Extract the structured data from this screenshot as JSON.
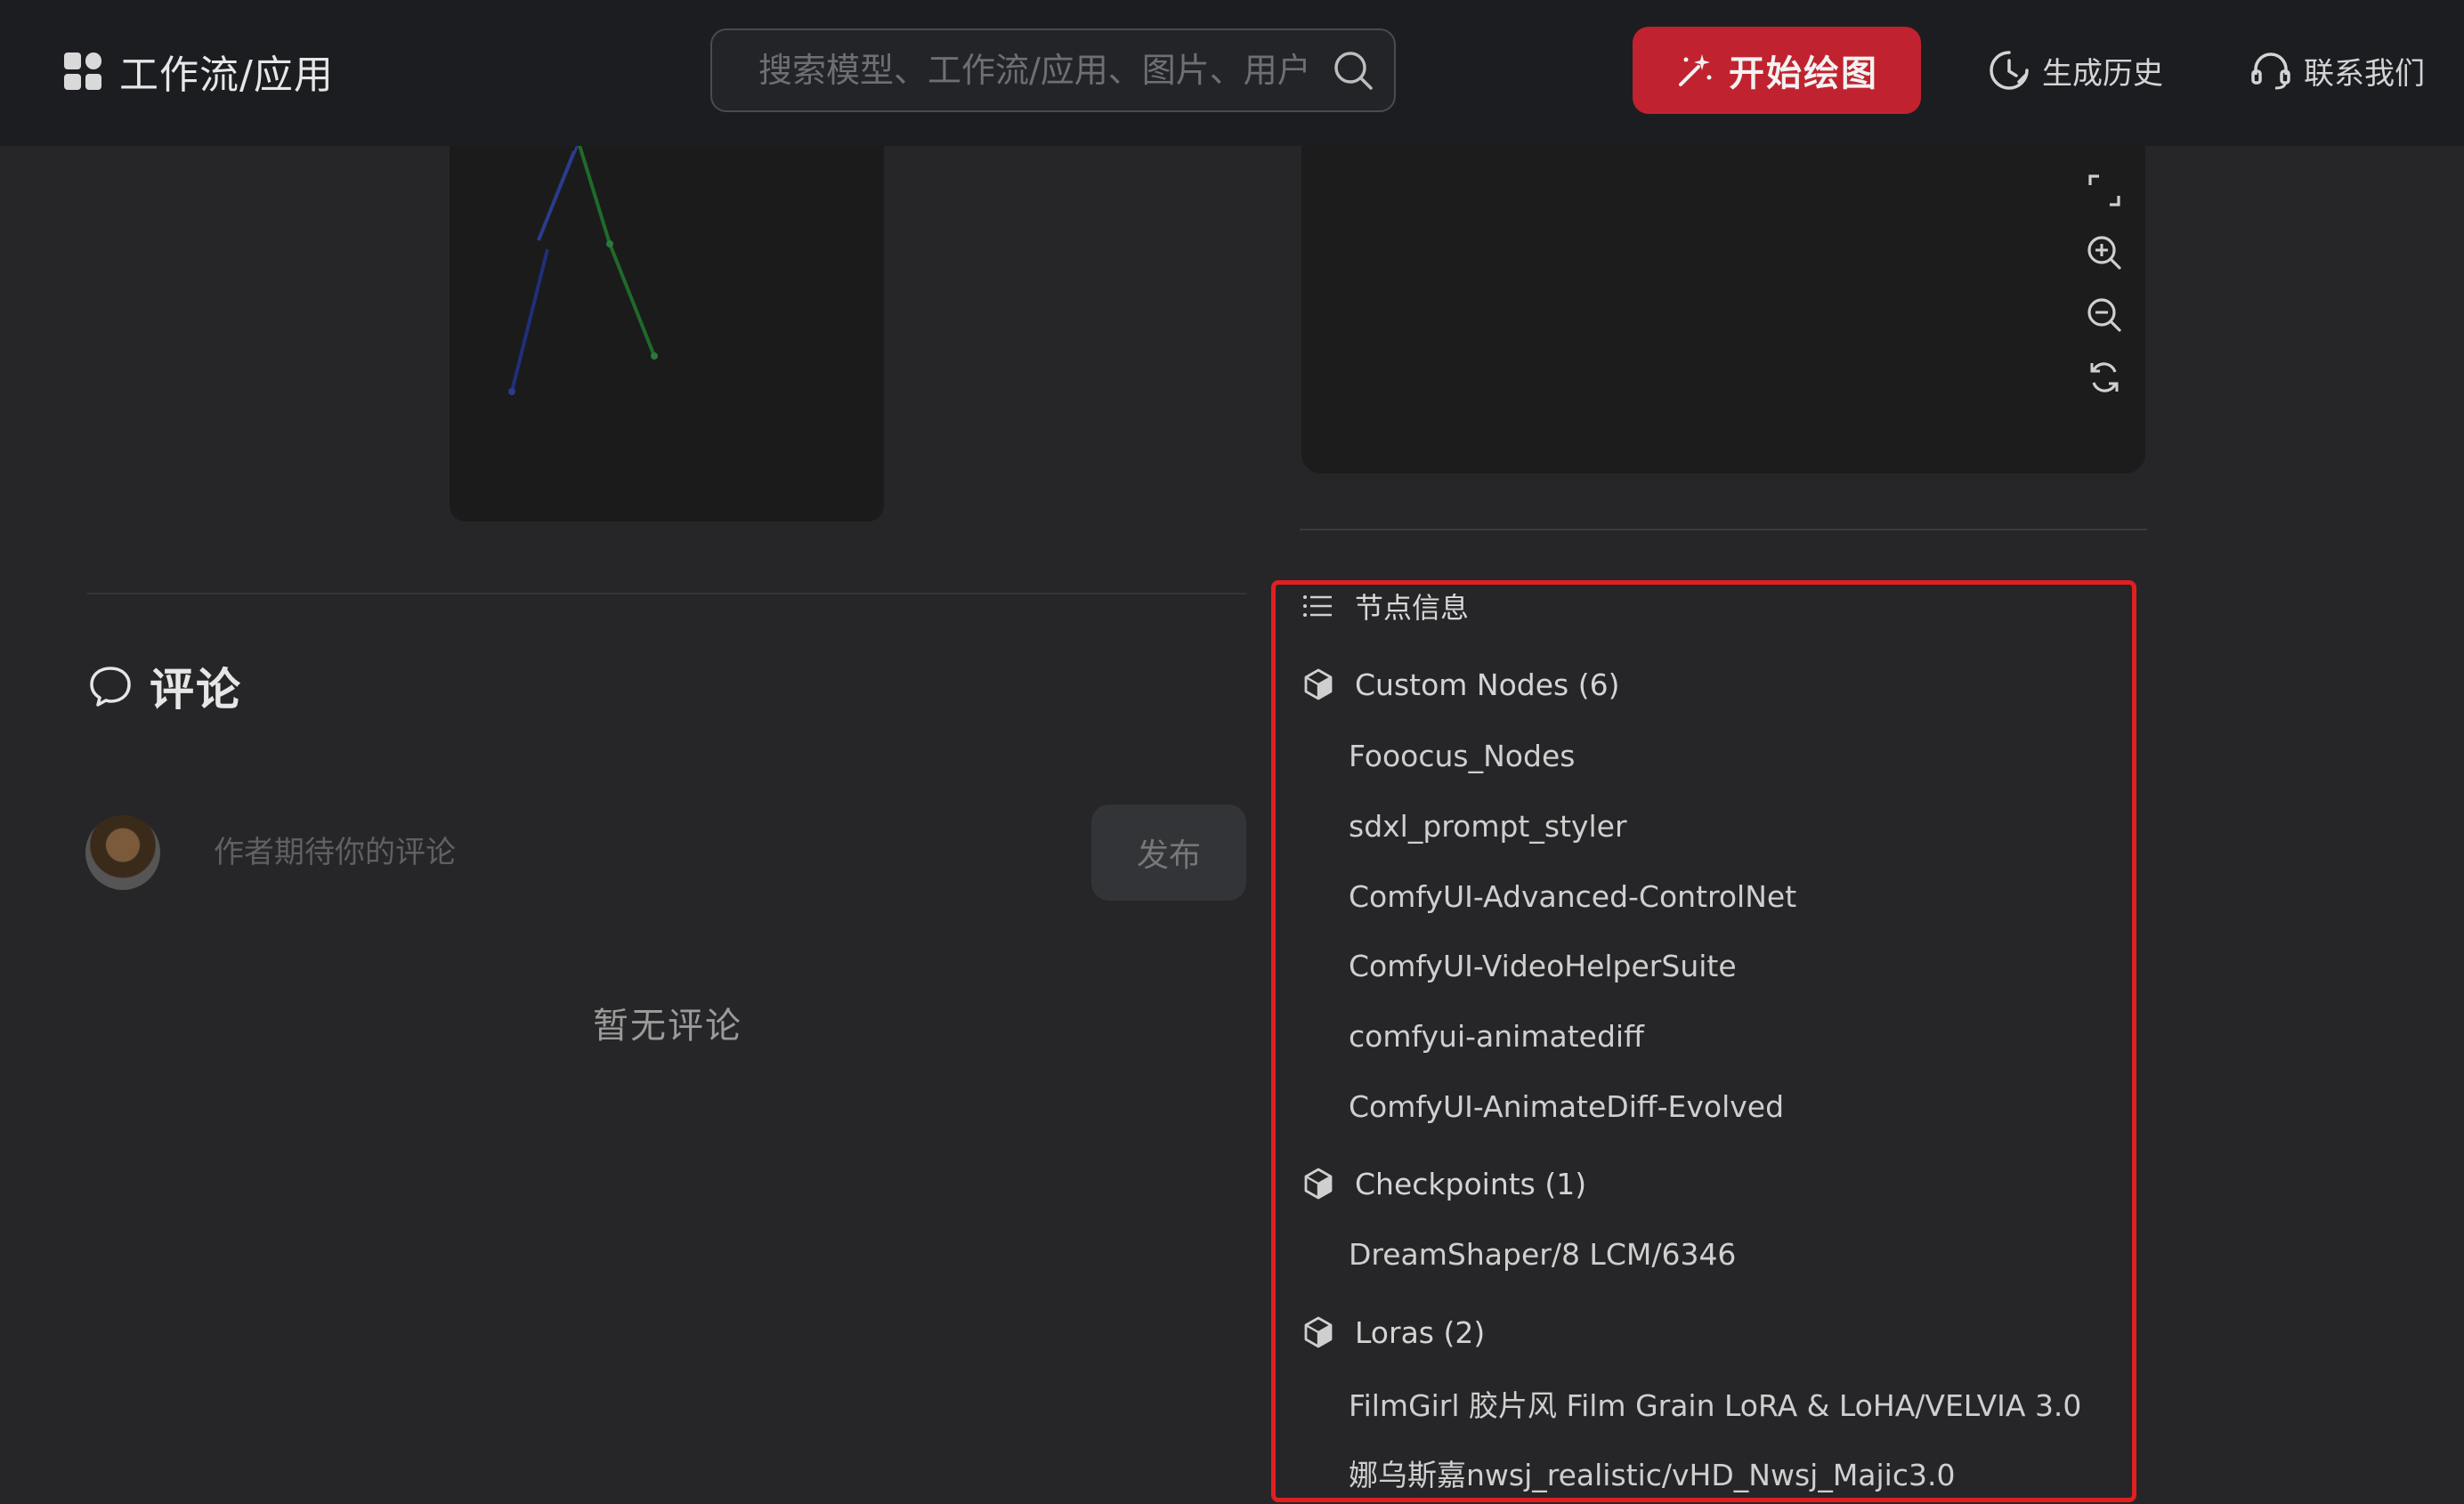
{
  "header": {
    "title": "工作流/应用",
    "search_placeholder": "搜索模型、工作流/应用、图片、用户",
    "start_label": "开始绘图",
    "history_label": "生成历史",
    "contact_label": "联系我们"
  },
  "comments": {
    "title": "评论",
    "input_placeholder": "作者期待你的评论",
    "publish_label": "发布",
    "empty_text": "暂无评论"
  },
  "node_info": {
    "title": "节点信息",
    "categories": [
      {
        "label": "Custom Nodes (6)",
        "items": [
          "Fooocus_Nodes",
          "sdxl_prompt_styler",
          "ComfyUI-Advanced-ControlNet",
          "ComfyUI-VideoHelperSuite",
          "comfyui-animatediff",
          "ComfyUI-AnimateDiff-Evolved"
        ]
      },
      {
        "label": "Checkpoints (1)",
        "items": [
          "DreamShaper/8 LCM/6346"
        ]
      },
      {
        "label": "Loras (2)",
        "items": [
          "FilmGirl 胶片风 Film Grain LoRA & LoHA/VELVIA 3.0",
          "娜乌斯嘉nwsj_realistic/vHD_Nwsj_Majic3.0"
        ]
      }
    ]
  },
  "colors": {
    "accent": "#c0232f",
    "highlight_border": "#e02020",
    "background": "#262628",
    "topbar": "#1c1d21"
  },
  "icons": [
    "apps-icon",
    "search-icon",
    "magic-wand-icon",
    "history-icon",
    "headset-icon",
    "comment-icon",
    "list-icon",
    "cube-icon",
    "fullscreen-icon",
    "zoom-in-icon",
    "zoom-out-icon",
    "refresh-icon"
  ]
}
